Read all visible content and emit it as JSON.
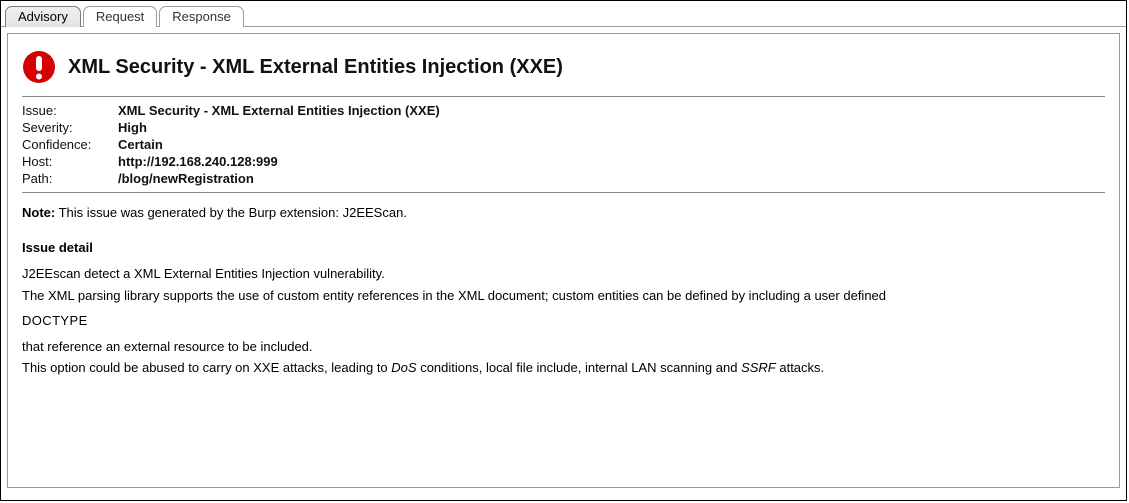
{
  "tabs": [
    {
      "label": "Advisory",
      "active": true
    },
    {
      "label": "Request",
      "active": false
    },
    {
      "label": "Response",
      "active": false
    }
  ],
  "icon_name": "alert-icon",
  "title": "XML Security - XML External Entities Injection (XXE)",
  "meta": {
    "issue_label": "Issue:",
    "issue_value": "XML Security - XML External Entities Injection (XXE)",
    "severity_label": "Severity:",
    "severity_value": "High",
    "confidence_label": "Confidence:",
    "confidence_value": "Certain",
    "host_label": "Host:",
    "host_value": "http://192.168.240.128:999",
    "path_label": "Path:",
    "path_value": "/blog/newRegistration"
  },
  "note": {
    "prefix": "Note:",
    "text": " This issue was generated by the Burp extension: J2EEScan."
  },
  "detail_heading": "Issue detail",
  "detail": {
    "line1": "J2EEscan detect a XML External Entities Injection vulnerability.",
    "line2": "The XML parsing library supports the use of custom entity references in the XML document; custom entities can be defined by including a user defined",
    "doctype": "DOCTYPE",
    "line4": "that reference an external resource to be included.",
    "line5a": "This option could be abused to carry on XXE attacks, leading to ",
    "line5_dos": "DoS",
    "line5b": " conditions, local file include, internal LAN scanning and ",
    "line5_ssrf": "SSRF",
    "line5c": " attacks."
  }
}
